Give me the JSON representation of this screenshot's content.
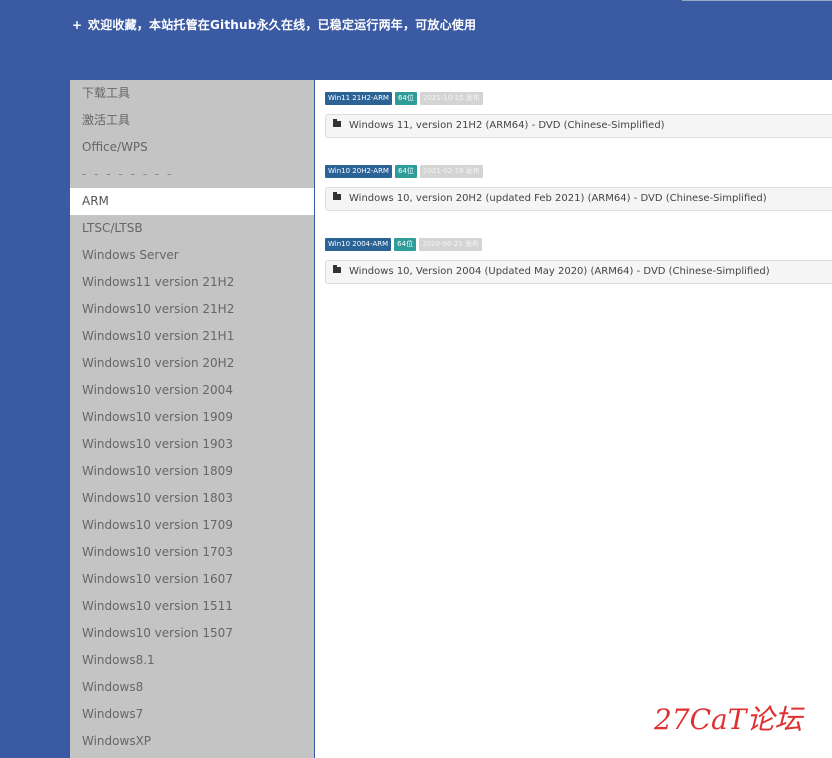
{
  "banner": {
    "plus": "+",
    "text": "欢迎收藏，本站托管在Github永久在线，已稳定运行两年，可放心使用"
  },
  "sidebar": {
    "items": [
      {
        "label": "下载工具"
      },
      {
        "label": "激活工具"
      },
      {
        "label": "Office/WPS"
      },
      {
        "label": "- - - - - - - -"
      },
      {
        "label": "ARM",
        "active": true
      },
      {
        "label": "LTSC/LTSB"
      },
      {
        "label": "Windows Server"
      },
      {
        "label": "Windows11 version 21H2"
      },
      {
        "label": "Windows10 version 21H2"
      },
      {
        "label": "Windows10 version 21H1"
      },
      {
        "label": "Windows10 version 20H2"
      },
      {
        "label": "Windows10 version 2004"
      },
      {
        "label": "Windows10 version 1909"
      },
      {
        "label": "Windows10 version 1903"
      },
      {
        "label": "Windows10 version 1809"
      },
      {
        "label": "Windows10 version 1803"
      },
      {
        "label": "Windows10 version 1709"
      },
      {
        "label": "Windows10 version 1703"
      },
      {
        "label": "Windows10 version 1607"
      },
      {
        "label": "Windows10 version 1511"
      },
      {
        "label": "Windows10 version 1507"
      },
      {
        "label": "Windows8.1"
      },
      {
        "label": "Windows8"
      },
      {
        "label": "Windows7"
      },
      {
        "label": "WindowsXP"
      }
    ]
  },
  "entries": [
    {
      "tag_name": "Win11 21H2-ARM",
      "tag_bits": "64位",
      "tag_date": "2021-10-15 发布",
      "file": "Windows 11, version 21H2 (ARM64) - DVD (Chinese-Simplified)"
    },
    {
      "tag_name": "Win10 20H2-ARM",
      "tag_bits": "64位",
      "tag_date": "2021-02-18 发布",
      "file": "Windows 10, version 20H2 (updated Feb 2021) (ARM64) - DVD (Chinese-Simplified)"
    },
    {
      "tag_name": "Win10 2004-ARM",
      "tag_bits": "64位",
      "tag_date": "2020-06-21 发布",
      "file": "Windows 10, Version 2004 (Updated May 2020) (ARM64) - DVD (Chinese-Simplified)"
    }
  ],
  "watermark": "27CaT论坛",
  "colors": {
    "background": "#3a5aa3",
    "sidebar": "#c4c4c4",
    "tag_name": "#2b6396",
    "tag_bits": "#2e9c99",
    "watermark": "#e03030"
  }
}
